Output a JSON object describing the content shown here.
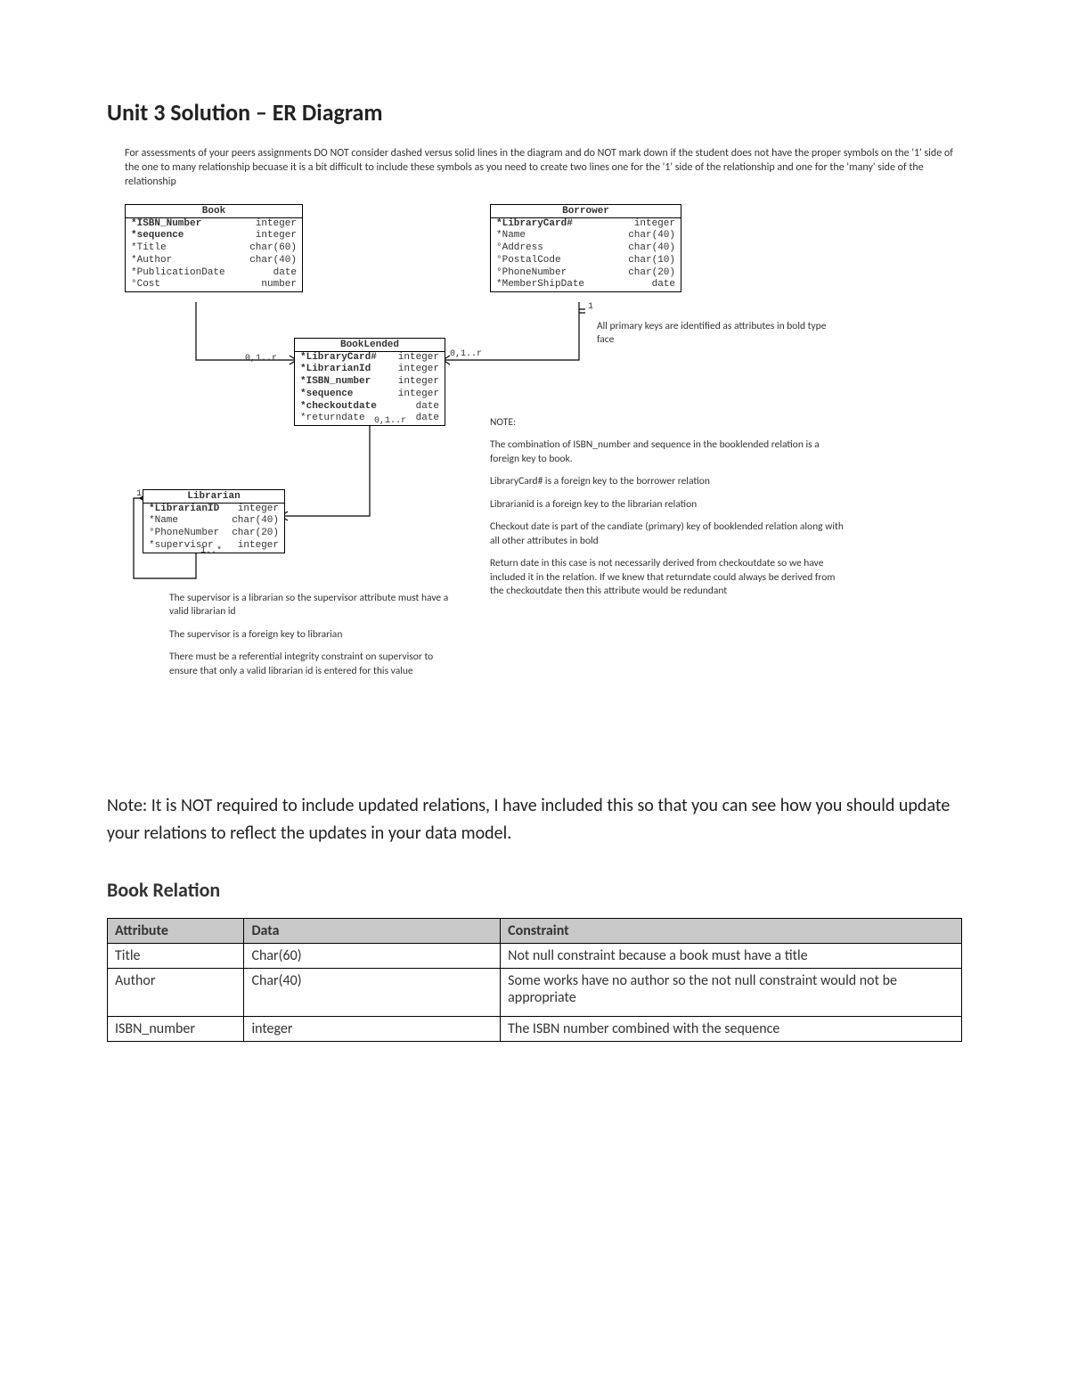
{
  "title": "Unit 3 Solution – ER Diagram",
  "intro": "For assessments of your peers assignments DO NOT consider dashed versus solid lines in the diagram and do NOT mark down if the student does not have the proper symbols on the '1' side of the one to many relationship becuase it is a bit difficult to include these symbols as you need to create two lines one for the '1' side of the relationship and one for the 'many' side of the relationship",
  "entities": {
    "book": {
      "name": "Book",
      "rows": [
        {
          "attr": "*ISBN_Number",
          "type": "integer",
          "bold": true
        },
        {
          "attr": "*sequence",
          "type": "integer",
          "bold": true
        },
        {
          "attr": "*Title",
          "type": "char(60)",
          "bold": false
        },
        {
          "attr": "*Author",
          "type": "char(40)",
          "bold": false
        },
        {
          "attr": "*PublicationDate",
          "type": "date",
          "bold": false
        },
        {
          "attr": "°Cost",
          "type": "number",
          "bold": false
        }
      ]
    },
    "borrower": {
      "name": "Borrower",
      "rows": [
        {
          "attr": "*LibraryCard#",
          "type": "integer",
          "bold": true
        },
        {
          "attr": "*Name",
          "type": "char(40)",
          "bold": false
        },
        {
          "attr": "°Address",
          "type": "char(40)",
          "bold": false
        },
        {
          "attr": "°PostalCode",
          "type": "char(10)",
          "bold": false
        },
        {
          "attr": "°PhoneNumber",
          "type": "char(20)",
          "bold": false
        },
        {
          "attr": "*MemberShipDate",
          "type": "date",
          "bold": false
        }
      ]
    },
    "booklended": {
      "name": "BookLended",
      "rows": [
        {
          "attr": "*LibraryCard#",
          "type": "integer",
          "bold": true
        },
        {
          "attr": "*LibrarianId",
          "type": "integer",
          "bold": true
        },
        {
          "attr": "*ISBN_number",
          "type": "integer",
          "bold": true
        },
        {
          "attr": "*sequence",
          "type": "integer",
          "bold": true
        },
        {
          "attr": "*checkoutdate",
          "type": "date",
          "bold": true
        },
        {
          "attr": "*returndate",
          "type": "date",
          "bold": false
        }
      ]
    },
    "librarian": {
      "name": "Librarian",
      "rows": [
        {
          "attr": "*LibrarianID",
          "type": "integer",
          "bold": true
        },
        {
          "attr": "*Name",
          "type": "char(40)",
          "bold": false
        },
        {
          "attr": "°PhoneNumber",
          "type": "char(20)",
          "bold": false
        },
        {
          "attr": "*supervisor",
          "type": "integer",
          "bold": false
        }
      ]
    }
  },
  "cardinalities": {
    "book_bl_left": "0,1..r",
    "bl_borrower_right": "0,1..r",
    "borrower_one": "1",
    "bl_down": "0,1..r",
    "lib_one": "1",
    "lib_self": "1..*"
  },
  "notes": {
    "pk": "All primary keys are identified as attributes in bold type face",
    "note_header": "NOTE:",
    "n1": "The combination of ISBN_number and sequence in the booklended relation is a foreign key to book.",
    "n2": "LibraryCard# is a foreign key to the borrower relation",
    "n3": "Librarianid is a foreign key to the librarian relation",
    "n4": "Checkout date is part of the candiate (primary) key of booklended relation along with all other attributes in bold",
    "n5": "Return date in this case is not necessarily derived from checkoutdate so we have included it in the relation.  If we knew that returndate could always be derived from the checkoutdate then this attribute would be redundant",
    "s1": "The supervisor is a librarian so the supervisor attribute must have a valid librarian id",
    "s2": "The supervisor is a foreign key to librarian",
    "s3": "There must be a referential integrity constraint on supervisor to ensure that only a valid librarian id is entered for this value"
  },
  "big_note": "Note: It is NOT required to include updated relations, I have included this so that you can see how you should update your relations to reflect the updates in your data model.",
  "relation_heading": "Book Relation",
  "table": {
    "headers": [
      "Attribute",
      "Data",
      "Constraint"
    ],
    "rows": [
      {
        "a": "Title",
        "d": "Char(60)",
        "c": "Not null constraint because a book must have a title"
      },
      {
        "a": "Author",
        "d": "Char(40)",
        "c": "Some works have no author so the not null constraint would not be appropriate"
      },
      {
        "a": "ISBN_number",
        "d": "integer",
        "c": "The ISBN number combined with the sequence"
      }
    ]
  }
}
